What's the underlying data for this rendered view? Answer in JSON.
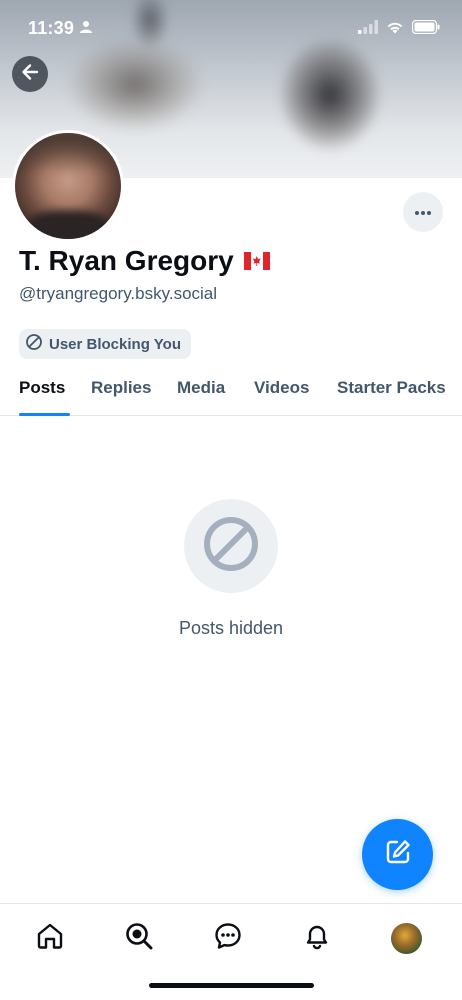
{
  "status_bar": {
    "time": "11:39",
    "icons": [
      "person-icon",
      "cellular-signal-icon",
      "wifi-icon",
      "battery-icon"
    ]
  },
  "header": {
    "back_icon": "arrow-left-icon",
    "more_icon": "ellipsis-icon"
  },
  "profile": {
    "display_name": "T. Ryan Gregory",
    "flag": "canada-flag",
    "handle": "@tryangregory.bsky.social",
    "badge_label": "User Blocking You",
    "badge_icon": "block-icon"
  },
  "tabs": [
    {
      "label": "Posts",
      "active": true
    },
    {
      "label": "Replies",
      "active": false
    },
    {
      "label": "Media",
      "active": false
    },
    {
      "label": "Videos",
      "active": false
    },
    {
      "label": "Starter Packs",
      "active": false
    }
  ],
  "empty_state": {
    "icon": "block-icon",
    "text": "Posts hidden"
  },
  "fab": {
    "icon": "compose-icon"
  },
  "bottom_nav": {
    "items": [
      "home-icon",
      "search-icon",
      "chat-icon",
      "bell-icon",
      "profile-avatar"
    ]
  },
  "colors": {
    "accent": "#1083fe",
    "text_primary": "#0b0f14",
    "text_secondary": "#42576c",
    "chip_background": "#edf0f3"
  }
}
